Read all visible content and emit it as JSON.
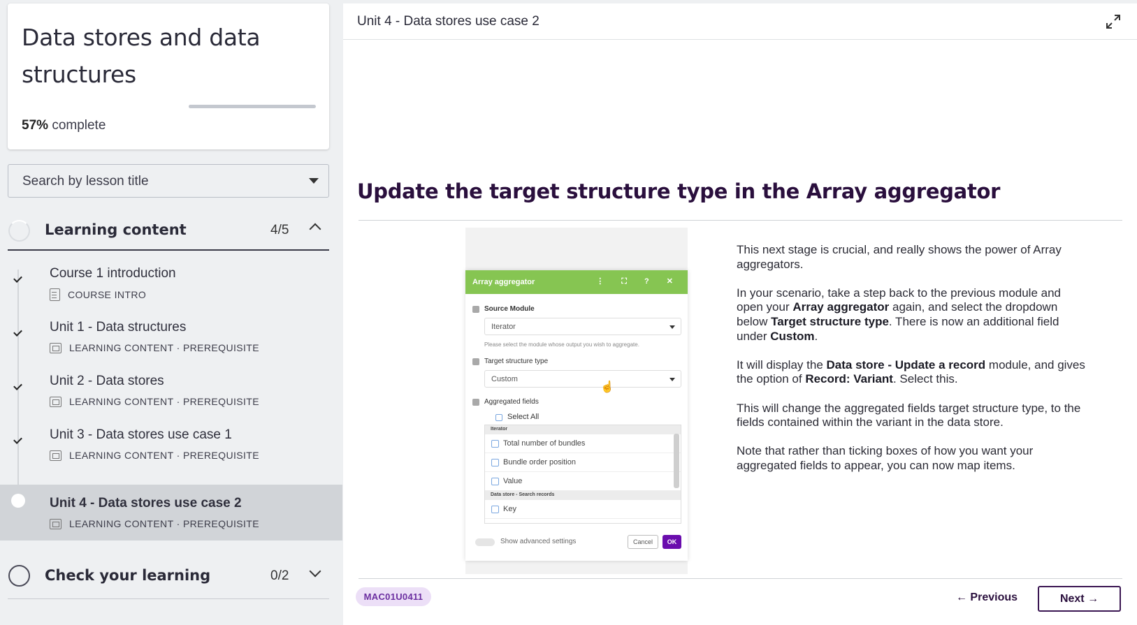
{
  "sidebar": {
    "course_title": "Data stores and data structures",
    "progress": {
      "percent": 57,
      "percent_label": "57%",
      "suffix": "complete"
    },
    "search": {
      "placeholder": "Search by lesson title"
    },
    "sections": [
      {
        "title": "Learning content",
        "count": "4/5",
        "expanded": true,
        "lessons": [
          {
            "title": "Course 1 introduction",
            "type": "COURSE INTRO",
            "tag": "",
            "status": "complete"
          },
          {
            "title": "Unit 1 - Data structures",
            "type": "LEARNING CONTENT",
            "tag": "PREREQUISITE",
            "status": "complete"
          },
          {
            "title": "Unit 2 - Data stores",
            "type": "LEARNING CONTENT",
            "tag": "PREREQUISITE",
            "status": "complete"
          },
          {
            "title": "Unit 3 - Data stores use case 1",
            "type": "LEARNING CONTENT",
            "tag": "PREREQUISITE",
            "status": "complete"
          },
          {
            "title": "Unit 4 - Data stores use case 2",
            "type": "LEARNING CONTENT",
            "tag": "PREREQUISITE",
            "status": "current"
          }
        ]
      },
      {
        "title": "Check your learning",
        "count": "0/2",
        "expanded": false
      }
    ],
    "meta_separator": "·"
  },
  "main": {
    "unit_title": "Unit 4 - Data stores use case 2",
    "heading": "Update the target structure type in the Array aggregator",
    "paragraphs": {
      "p1": "This next stage is crucial, and really shows the power of Array aggregators.",
      "p2_a": "In your scenario, take a step back to the previous module and open your ",
      "p2_b": "Array aggregator",
      "p2_c": " again, and select the dropdown below ",
      "p2_d": "Target structure type",
      "p2_e": ". There is now an additional field under ",
      "p2_f": "Custom",
      "p2_g": ".",
      "p3_a": "It will display the ",
      "p3_b": "Data store - Update a record",
      "p3_c": " module, and gives the option of ",
      "p3_d": "Record: Variant",
      "p3_e": ". Select this.",
      "p4": "This will change the aggregated fields target structure type, to the fields contained within the variant in the data store.",
      "p5": "Note that rather than ticking boxes of how you want your aggregated fields to appear, you can now map items."
    },
    "screenshot": {
      "title": "Array aggregator",
      "header_icons": "⋮ ⛶ ? ✕",
      "source_module_label": "Source Module",
      "source_module_value": "Iterator",
      "hint": "Please select the module whose output you wish to aggregate.",
      "target_label": "Target structure type",
      "target_value": "Custom",
      "aggregated_label": "Aggregated fields",
      "select_all": "Select All",
      "group1": "Iterator",
      "items1": [
        "Total number of bundles",
        "Bundle order position",
        "Value"
      ],
      "group2": "Data store - Search records",
      "items2": [
        "Key"
      ],
      "advanced": "Show advanced settings",
      "cancel": "Cancel",
      "ok": "OK"
    },
    "lesson_code": "MAC01U0411",
    "prev_label": "← Previous",
    "next_label": "Next →"
  }
}
